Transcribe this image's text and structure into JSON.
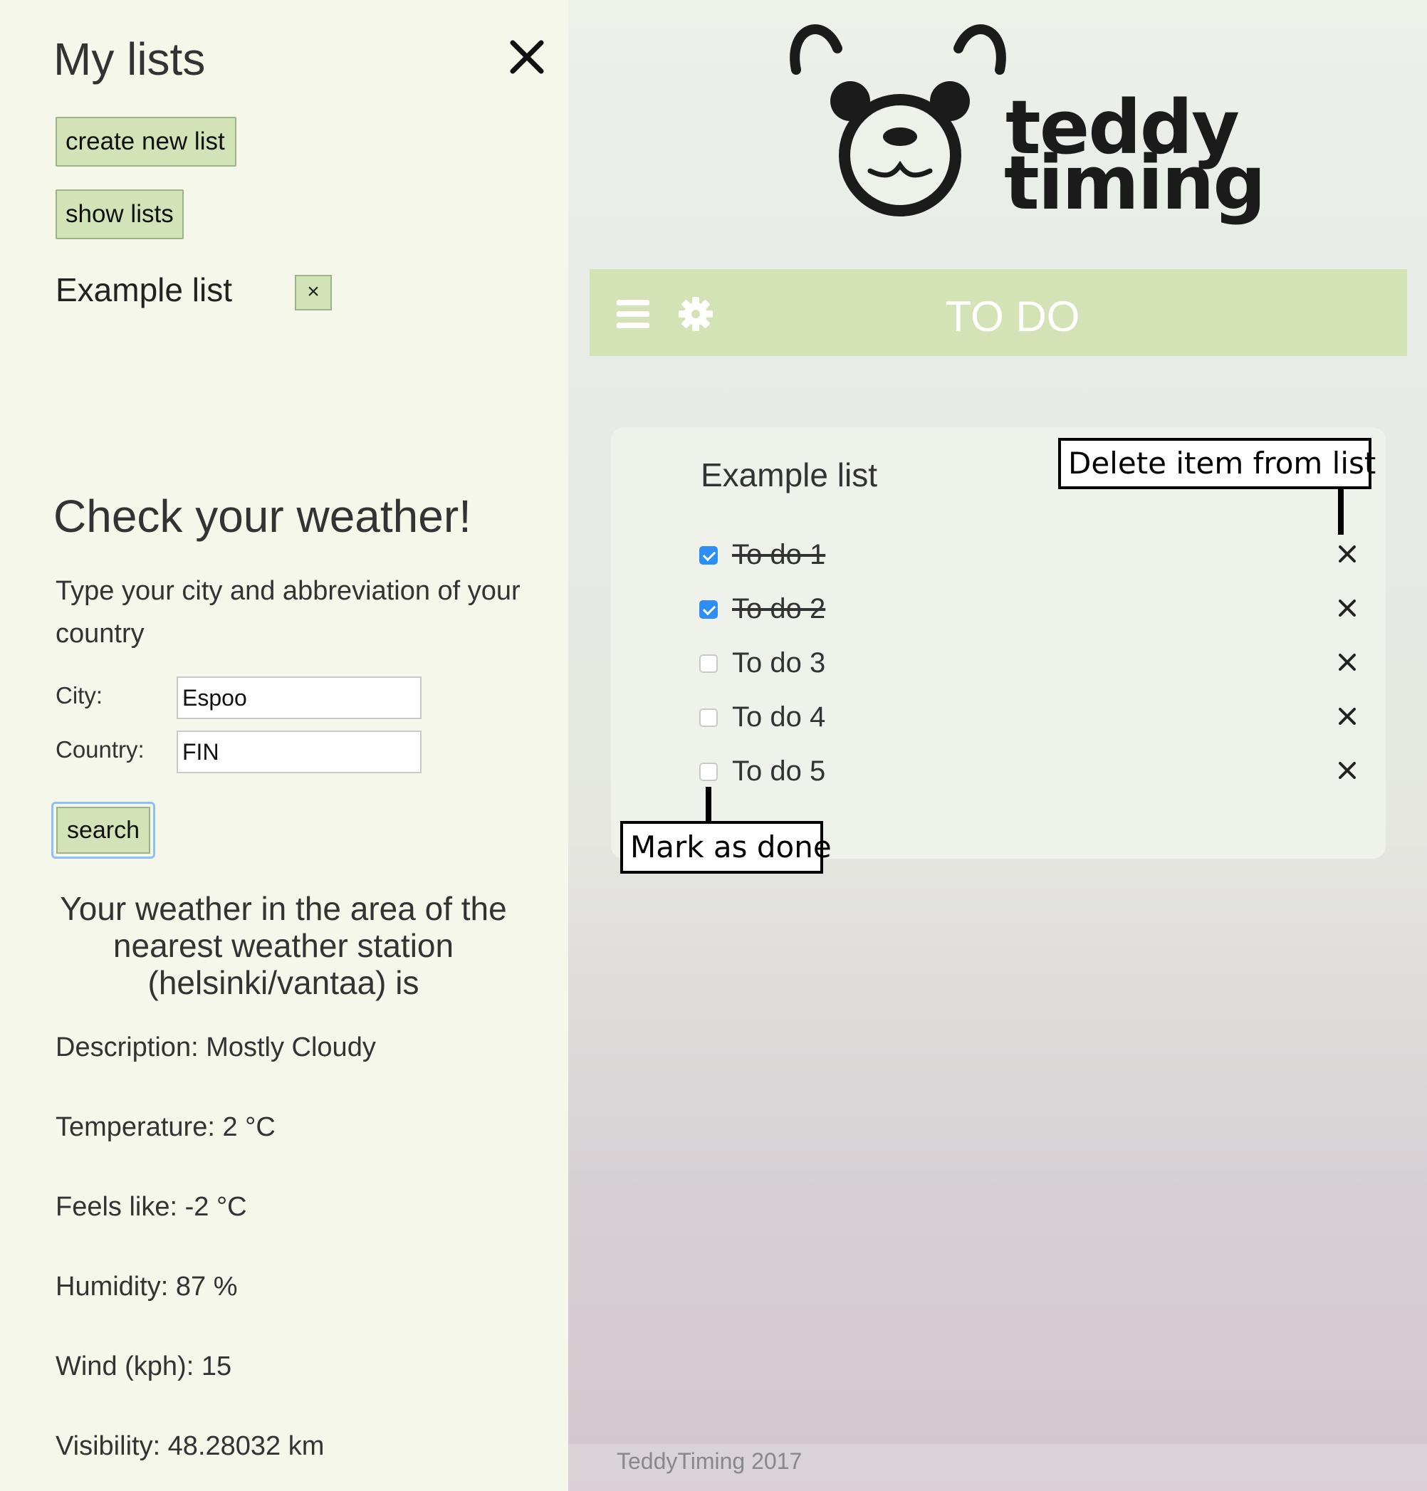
{
  "sidebar": {
    "title": "My lists",
    "create_button": "create new list",
    "show_button": "show lists",
    "list_entry": "Example list",
    "list_delete_glyph": "×",
    "weather": {
      "title": "Check your weather!",
      "intro": "Type your city and abbreviation of your country",
      "city_label": "City:",
      "city_value": "Espoo",
      "country_label": "Country:",
      "country_value": "FIN",
      "search_button": "search",
      "result_heading": "Your weather in the area of the nearest weather station (helsinki/vantaa) is",
      "details": [
        "Description: Mostly Cloudy",
        "Temperature: 2 °C",
        "Feels like: -2 °C",
        "Humidity: 87 %",
        "Wind (kph): 15",
        "Visibility: 48.28032 km"
      ]
    }
  },
  "brand": {
    "line1": "teddy",
    "line2": "timing"
  },
  "topbar": {
    "title": "TO DO",
    "icons": [
      "menu-icon",
      "gear-icon"
    ]
  },
  "list": {
    "title": "Example list",
    "items": [
      {
        "label": "To do 1",
        "done": true
      },
      {
        "label": "To do 2",
        "done": true
      },
      {
        "label": "To do 3",
        "done": false
      },
      {
        "label": "To do 4",
        "done": false
      },
      {
        "label": "To do 5",
        "done": false
      }
    ]
  },
  "annotations": {
    "delete": "Delete item from list",
    "mark": "Mark as done"
  },
  "footer": {
    "text": "TeddyTiming 2017"
  },
  "colors": {
    "accent_green": "#d4e3b6",
    "sidebar_bg": "#f4f7ea",
    "checkbox_blue": "#2d8ef5"
  }
}
